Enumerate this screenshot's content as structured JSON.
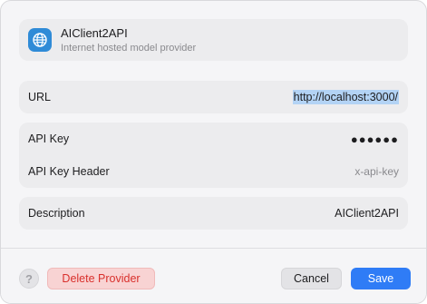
{
  "provider": {
    "name": "AIClient2API",
    "subtitle": "Internet hosted model provider",
    "icon": "globe-icon",
    "icon_color": "#2f8bd7"
  },
  "fields": {
    "url": {
      "label": "URL",
      "value": "http://localhost:3000/"
    },
    "api_key": {
      "label": "API Key",
      "value": "●●●●●●"
    },
    "api_key_header": {
      "label": "API Key Header",
      "value": "x-api-key"
    },
    "description": {
      "label": "Description",
      "value": "AIClient2API"
    }
  },
  "footer": {
    "help_label": "?",
    "delete_label": "Delete Provider",
    "cancel_label": "Cancel",
    "save_label": "Save"
  },
  "colors": {
    "accent": "#2f7cf6",
    "danger_text": "#d9302c",
    "danger_bg": "#f8d3d3"
  }
}
